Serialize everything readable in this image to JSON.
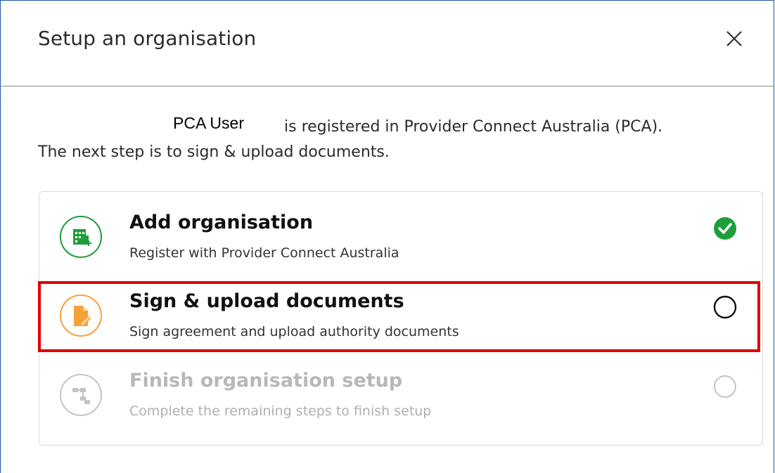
{
  "dialog": {
    "title": "Setup an organisation",
    "close_icon": "close-icon"
  },
  "intro": {
    "user_name": "PCA User",
    "line1_rest": "is registered in Provider Connect Australia (PCA).",
    "line2": "The next step is to sign & upload documents."
  },
  "steps": [
    {
      "title": "Add organisation",
      "description": "Register with Provider Connect Australia",
      "icon": "building-add-icon",
      "status": "completed",
      "status_icon": "check-circle-icon",
      "color": "#1e9e3a"
    },
    {
      "title": "Sign & upload documents",
      "description": "Sign agreement and upload authority documents",
      "icon": "document-sign-icon",
      "status": "current",
      "status_icon": "empty-circle-icon",
      "color": "#f5a23a",
      "highlighted": true
    },
    {
      "title": "Finish organisation setup",
      "description": "Complete the remaining steps to finish setup",
      "icon": "hierarchy-icon",
      "status": "disabled",
      "status_icon": "empty-circle-icon",
      "color": "#c4c4c4"
    }
  ],
  "colors": {
    "highlight": "#e00000",
    "success": "#1e9e3a",
    "accent": "#f5a23a",
    "disabled": "#c4c4c4"
  }
}
